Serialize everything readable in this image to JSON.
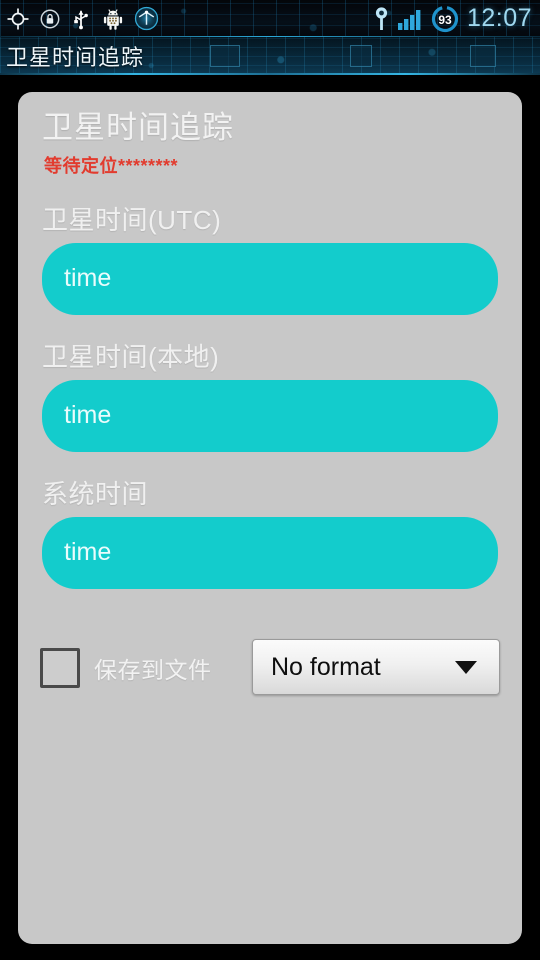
{
  "status_bar": {
    "icons": [
      {
        "name": "gps-location-icon"
      },
      {
        "name": "silent-lock-icon"
      },
      {
        "name": "usb-icon"
      },
      {
        "name": "android-robot-icon"
      },
      {
        "name": "network-globe-icon"
      },
      {
        "name": "gps-pin-icon"
      },
      {
        "name": "signal-bars-icon"
      }
    ],
    "battery_level": "93",
    "clock": "12:07"
  },
  "title_bar": {
    "app_title": "卫星时间追踪"
  },
  "panel": {
    "heading": "卫星时间追踪",
    "status_text": "等待定位********",
    "status_color": "#e23b2e",
    "accent_color": "#13cccc",
    "fields": [
      {
        "label": "卫星时间(UTC)",
        "value": "",
        "placeholder": "time"
      },
      {
        "label": "卫星时间(本地)",
        "value": "",
        "placeholder": "time"
      },
      {
        "label": "系统时间",
        "value": "",
        "placeholder": "time"
      }
    ],
    "save_to_file": {
      "label": "保存到文件",
      "checked": false
    },
    "format_select": {
      "selected": "No format",
      "caret": "chevron-down-icon"
    }
  }
}
